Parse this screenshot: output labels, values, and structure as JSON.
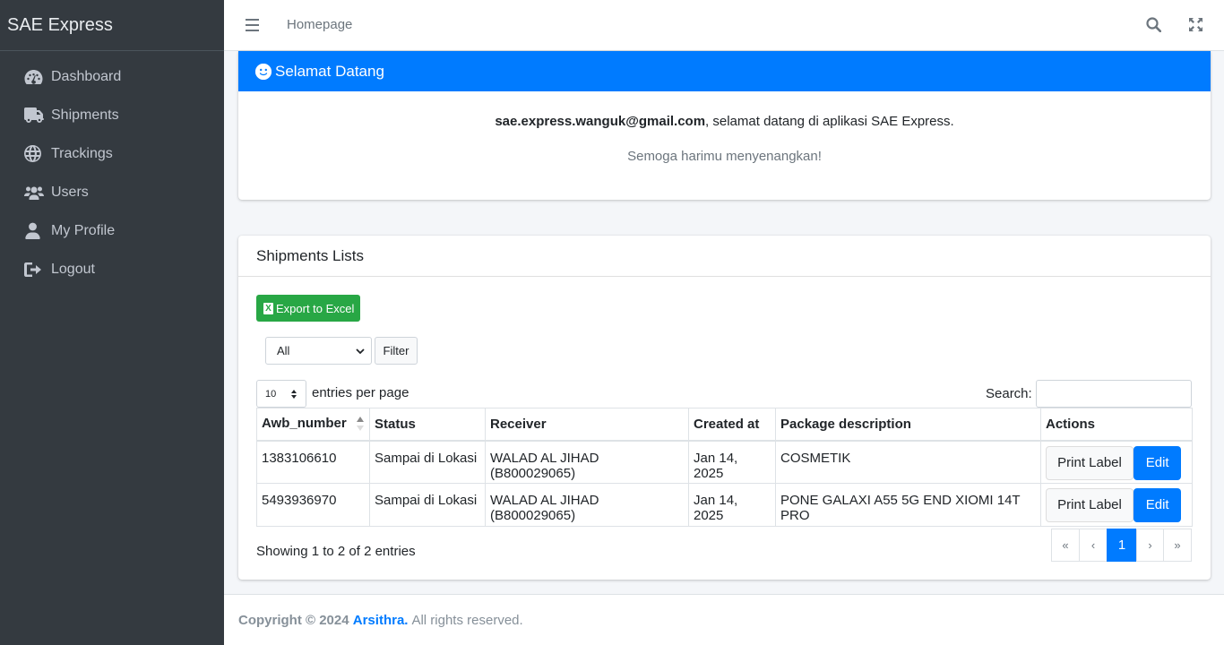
{
  "brand": "SAE Express",
  "sidebar": {
    "items": [
      {
        "label": "Dashboard",
        "icon": "dashboard-icon"
      },
      {
        "label": "Shipments",
        "icon": "truck-icon"
      },
      {
        "label": "Trackings",
        "icon": "globe-icon"
      },
      {
        "label": "Users",
        "icon": "users-icon"
      },
      {
        "label": "My Profile",
        "icon": "user-icon"
      },
      {
        "label": "Logout",
        "icon": "logout-icon"
      }
    ]
  },
  "topbar": {
    "breadcrumb": "Homepage",
    "icons": [
      "hamburger-icon",
      "search-icon",
      "expand-icon"
    ]
  },
  "welcome": {
    "title": "Selamat Datang",
    "email": "sae.express.wanguk@gmail.com",
    "message": ", selamat datang di aplikasi SAE Express.",
    "subtitle": "Semoga harimu menyenangkan!"
  },
  "shipments": {
    "title": "Shipments Lists",
    "export_label": "Export to Excel",
    "filter_value": "All",
    "filter_button": "Filter",
    "page_length": "10",
    "entries_label": "entries per page",
    "search_label": "Search:",
    "search_value": "",
    "columns": [
      "Awb_number",
      "Status",
      "Receiver",
      "Created at",
      "Package description",
      "Actions"
    ],
    "rows": [
      {
        "awb": "1383106610",
        "status": "Sampai di Lokasi",
        "receiver": "WALAD AL JIHAD (B800029065)",
        "created": "Jan 14, 2025",
        "desc": "COSMETIK"
      },
      {
        "awb": "5493936970",
        "status": "Sampai di Lokasi",
        "receiver": "WALAD AL JIHAD (B800029065)",
        "created": "Jan 14, 2025",
        "desc": "PONE GALAXI A55 5G END XIOMI 14T PRO"
      }
    ],
    "print_label": "Print Label",
    "edit_label": "Edit",
    "info": "Showing 1 to 2 of 2 entries",
    "pager": {
      "first": "«",
      "prev": "‹",
      "current": "1",
      "next": "›",
      "last": "»"
    }
  },
  "footer": {
    "copyright": "Copyright © 2024",
    "company": "Arsithra.",
    "rights": "All rights reserved."
  },
  "colors": {
    "sidebar": "#343a40",
    "primary": "#007bff",
    "success": "#28a745"
  }
}
